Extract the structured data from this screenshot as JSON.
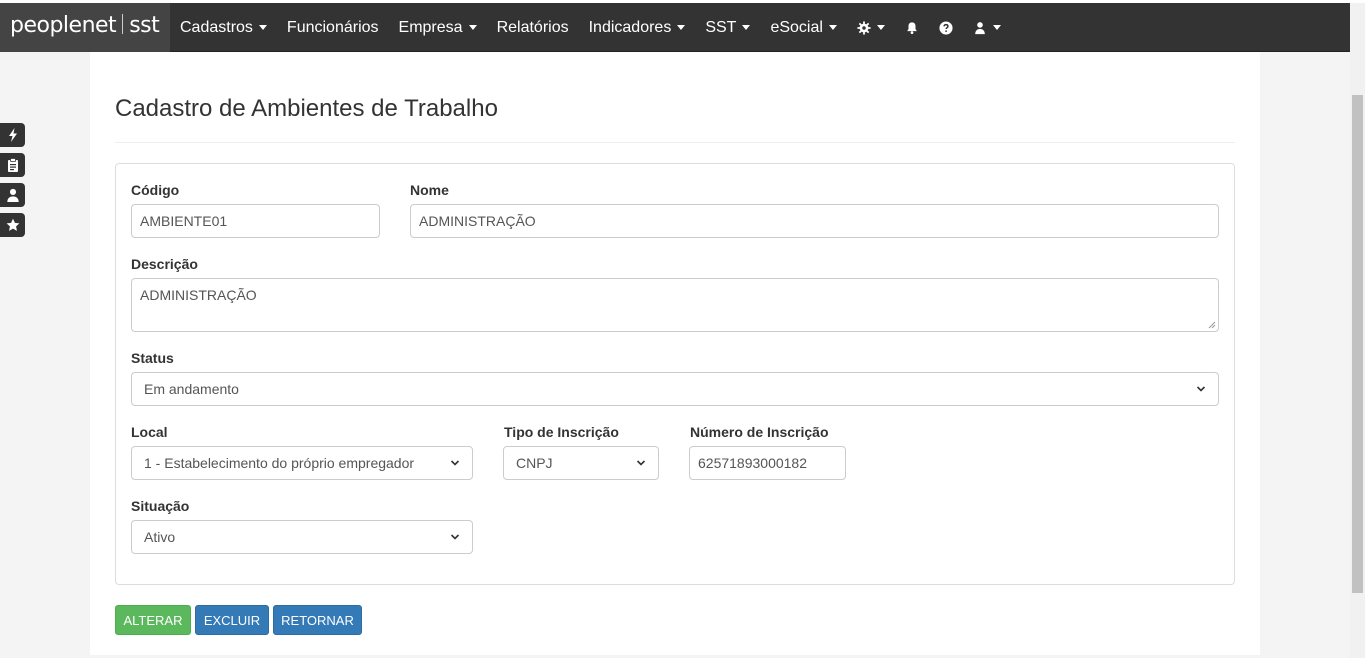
{
  "navbar": {
    "brand_main": "peoplenet",
    "brand_sub": "sst",
    "items": [
      {
        "label": "Cadastros",
        "dropdown": true
      },
      {
        "label": "Funcionários",
        "dropdown": false
      },
      {
        "label": "Empresa",
        "dropdown": true
      },
      {
        "label": "Relatórios",
        "dropdown": false
      },
      {
        "label": "Indicadores",
        "dropdown": true
      },
      {
        "label": "SST",
        "dropdown": true
      },
      {
        "label": "eSocial",
        "dropdown": true
      }
    ],
    "icons": [
      "gear-icon",
      "bell-icon",
      "question-circle-icon",
      "user-icon"
    ]
  },
  "side_buttons": [
    "bolt-icon",
    "clipboard-icon",
    "user-icon",
    "star-icon"
  ],
  "page": {
    "title": "Cadastro de Ambientes de Trabalho"
  },
  "form": {
    "codigo": {
      "label": "Código",
      "value": "AMBIENTE01"
    },
    "nome": {
      "label": "Nome",
      "value": "ADMINISTRAÇÃO"
    },
    "descricao": {
      "label": "Descrição",
      "value": "ADMINISTRAÇÃO"
    },
    "status": {
      "label": "Status",
      "value": "Em andamento"
    },
    "local": {
      "label": "Local",
      "value": "1 - Estabelecimento do próprio empregador"
    },
    "tipo_inscricao": {
      "label": "Tipo de Inscrição",
      "value": "CNPJ"
    },
    "numero_inscricao": {
      "label": "Número de Inscrição",
      "value": "62571893000182"
    },
    "situacao": {
      "label": "Situação",
      "value": "Ativo"
    }
  },
  "buttons": {
    "alterar": "ALTERAR",
    "excluir": "EXCLUIR",
    "retornar": "RETORNAR"
  },
  "colors": {
    "navbar": "#333333",
    "success": "#5cb85c",
    "primary": "#337ab7"
  }
}
